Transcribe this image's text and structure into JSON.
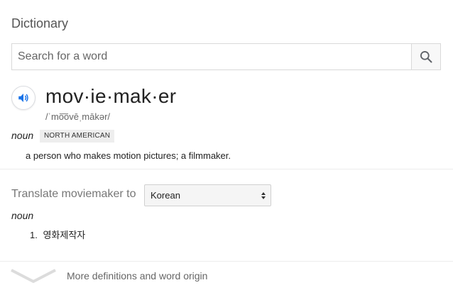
{
  "panel": {
    "title": "Dictionary"
  },
  "search": {
    "placeholder": "Search for a word",
    "icon": "search-icon"
  },
  "entry": {
    "audio_icon": "speaker-icon",
    "headword": "mov·ie·mak·er",
    "phonetic": "/ˈmo͞ovēˌmākər/",
    "part_of_speech": "noun",
    "region": "NORTH AMERICAN",
    "definition": "a person who makes motion pictures; a filmmaker."
  },
  "translate": {
    "label": "Translate moviemaker to",
    "selected_language": "Korean",
    "part_of_speech": "noun",
    "items": [
      {
        "number": "1.",
        "text": "영화제작자"
      }
    ]
  },
  "footer": {
    "more_label": "More definitions and word origin",
    "icon": "chevron-down-icon"
  },
  "colors": {
    "accent_blue": "#1a73e8",
    "muted_text": "#777777",
    "divider": "#ececec"
  }
}
